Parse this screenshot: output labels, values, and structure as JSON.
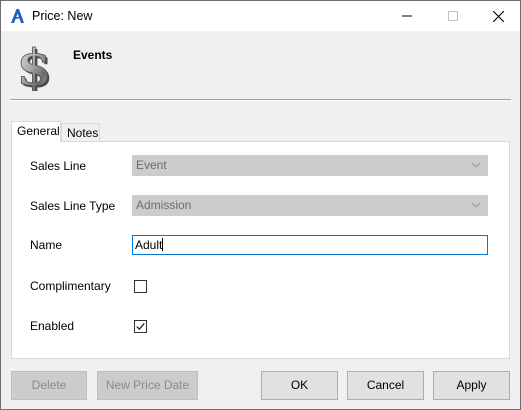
{
  "window": {
    "title": "Price: New"
  },
  "header": {
    "title": "Events",
    "icon": "dollar-sign-icon"
  },
  "tabs": [
    {
      "label": "General",
      "selected": true
    },
    {
      "label": "Notes",
      "selected": false
    }
  ],
  "form": {
    "sales_line": {
      "label": "Sales Line",
      "value": "Event"
    },
    "sales_line_type": {
      "label": "Sales Line Type",
      "value": "Admission"
    },
    "name": {
      "label": "Name",
      "value": "Adult"
    },
    "complimentary": {
      "label": "Complimentary",
      "checked": false
    },
    "enabled": {
      "label": "Enabled",
      "checked": true
    }
  },
  "buttons": {
    "delete": "Delete",
    "new_price_date": "New Price Date",
    "ok": "OK",
    "cancel": "Cancel",
    "apply": "Apply"
  },
  "colors": {
    "focus_border": "#0078d7",
    "disabled_bg": "#cccccc",
    "window_bg": "#f0f0f0"
  }
}
